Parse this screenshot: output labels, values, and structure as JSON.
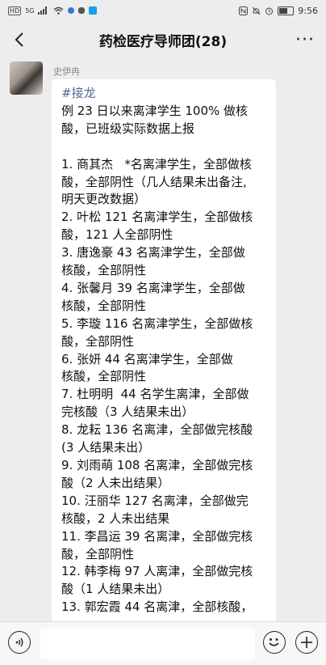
{
  "status_bar": {
    "network_label": "HD",
    "signal_label": "5G",
    "time": "9:56",
    "battery_level": 0.55
  },
  "header": {
    "title": "药检医疗导师团(28)",
    "back_icon": "chevron-left-icon",
    "more_icon": "more-dots-icon",
    "more_label": "···"
  },
  "message": {
    "sender": "史伊冉",
    "tag": "#接龙",
    "lines": [
      "例 23 日以来离津学生 100% 做核",
      "酸，已班级实际数据上报",
      "",
      "1. 商其杰   *名离津学生，全部做核",
      "酸，全部阴性（几人结果未出备注,",
      "明天更改数据）",
      "2. 叶松 121 名离津学生，全部做核",
      "酸，121 人全部阴性",
      "3. 唐逸豪 43 名离津学生，全部做",
      "核酸，全部阴性",
      "4. 张馨月 39 名离津学生，全部做",
      "核酸，全部阴性",
      "5. 李璇 116 名离津学生，全部做核",
      "酸，全部阴性",
      "6. 张妍 44 名离津学生，全部做",
      "核酸，全部阴性",
      "7. 杜明明  44 名学生离津，全部做",
      "完核酸（3 人结果未出）",
      "8. 龙耘 136 名离津，全部做完核酸",
      "(3 人结果未出）",
      "9. 刘雨萌 108 名离津，全部做完核",
      "酸（2 人未出结果）",
      "10. 汪丽华 127 名离津，全部做完",
      "核酸，2 人未出结果",
      "11. 李昌运 39 名离津，全部做完核",
      "酸，全部阴性",
      "12. 韩李梅 97 人离津，全部做完核",
      "酸（1 人结果未出）",
      "13. 郭宏霞 44 名离津，全部核酸，"
    ]
  },
  "input_bar": {
    "voice_icon": "voice-icon",
    "emoji_icon": "emoji-icon",
    "plus_icon": "plus-icon",
    "placeholder": ""
  }
}
